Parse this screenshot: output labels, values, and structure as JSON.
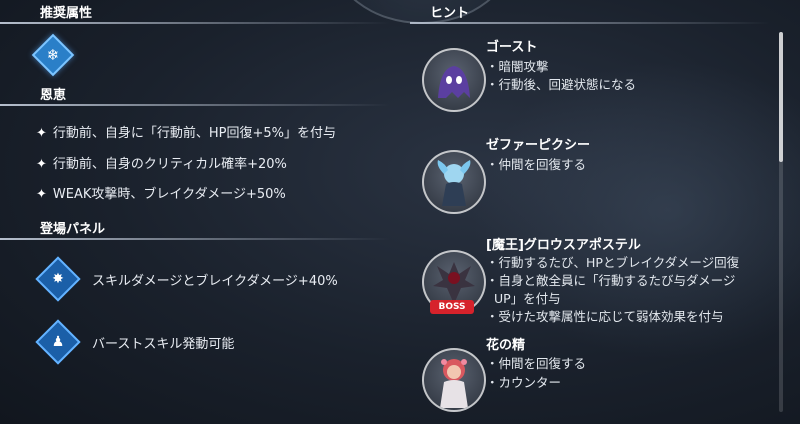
{
  "recommended": {
    "title": "推奨属性",
    "attribute_icon": "ice-snowflake-icon"
  },
  "benefits": {
    "title": "恩恵",
    "items": [
      "行動前、自身に「行動前、HP回復+5%」を付与",
      "行動前、自身のクリティカル確率+20%",
      "WEAK攻撃時、ブレイクダメージ+50%"
    ]
  },
  "panels": {
    "title": "登場パネル",
    "items": [
      {
        "icon": "skill-damage-panel-icon",
        "label": "スキルダメージとブレイクダメージ+40%"
      },
      {
        "icon": "burst-skill-panel-icon",
        "label": "バーストスキル発動可能"
      }
    ]
  },
  "hints": {
    "title": "ヒント",
    "enemies": [
      {
        "name": "ゴースト",
        "desc": [
          "・暗闇攻撃",
          "・行動後、回避状態になる"
        ],
        "boss": false
      },
      {
        "name": "ゼファーピクシー",
        "desc": [
          "・仲間を回復する"
        ],
        "boss": false
      },
      {
        "name": "[魔王]グロウスアポステル",
        "desc": [
          "・行動するたび、HPとブレイクダメージ回復",
          "・自身と敵全員に「行動するたび与ダメージ",
          "UP」を付与",
          "・受けた攻撃属性に応じて弱体効果を付与"
        ],
        "boss": true,
        "boss_label": "BOSS"
      },
      {
        "name": "花の精",
        "desc": [
          "・仲間を回復する",
          "・カウンター"
        ],
        "boss": false
      }
    ]
  },
  "colors": {
    "accent": "#2a7fc8",
    "boss": "#d6222b"
  }
}
